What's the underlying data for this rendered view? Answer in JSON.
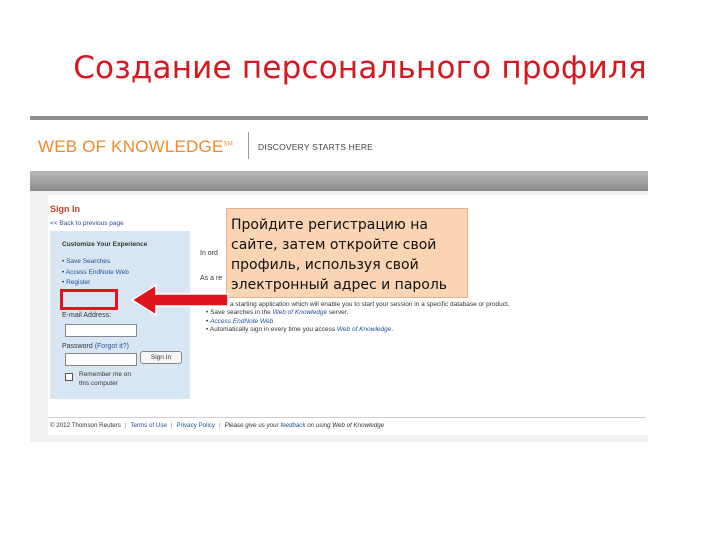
{
  "slide": {
    "title": "Создание персонального профиля"
  },
  "wok": {
    "logo": "WEB OF KNOWLEDGE",
    "logo_mark": "SM",
    "tagline": "DISCOVERY STARTS HERE"
  },
  "signin": {
    "title": "Sign In",
    "back_link": "<< Back to previous page",
    "box_heading": "Customize Your Experience",
    "items": [
      "Save Searches",
      "Access EndNote Web",
      "Register"
    ],
    "email_label": "E-mail Address:",
    "password_label": "Password",
    "forgot_link": "(Forgot it?)",
    "signin_button": "Sign In",
    "remember_label": "Remember me on this computer"
  },
  "main": {
    "intro_fragment": "In ord",
    "intro_fragment2": "As a re",
    "list": [
      {
        "text": "Select a starting application which will enable you to start your session in a specific database or product."
      },
      {
        "pre": "Save searches in the ",
        "link": "Web of Knowledge",
        "post": " server."
      },
      {
        "pre": "",
        "link": "Access EndNote Web",
        "post": ""
      },
      {
        "pre": "Automatically sign in every time you access ",
        "link": "Web of Knowledge",
        "post": "."
      }
    ]
  },
  "footer": {
    "copyright": "© 2012 Thomson Reuters",
    "terms": "Terms of Use",
    "privacy": "Privacy Policy",
    "feedback_pre": "Please give us your ",
    "feedback_link": "feedback",
    "feedback_post": " on using Web of Knowledge"
  },
  "callout": {
    "text": "Пройдите регистрацию на сайте, затем откройте свой профиль, используя свой электронный адрес и пароль"
  },
  "colors": {
    "title_red": "#d6171e",
    "logo_orange": "#f08a2c",
    "link_blue": "#1e4f99",
    "callout_bg": "#fbd4b4",
    "highlight_red": "#e0141c"
  }
}
